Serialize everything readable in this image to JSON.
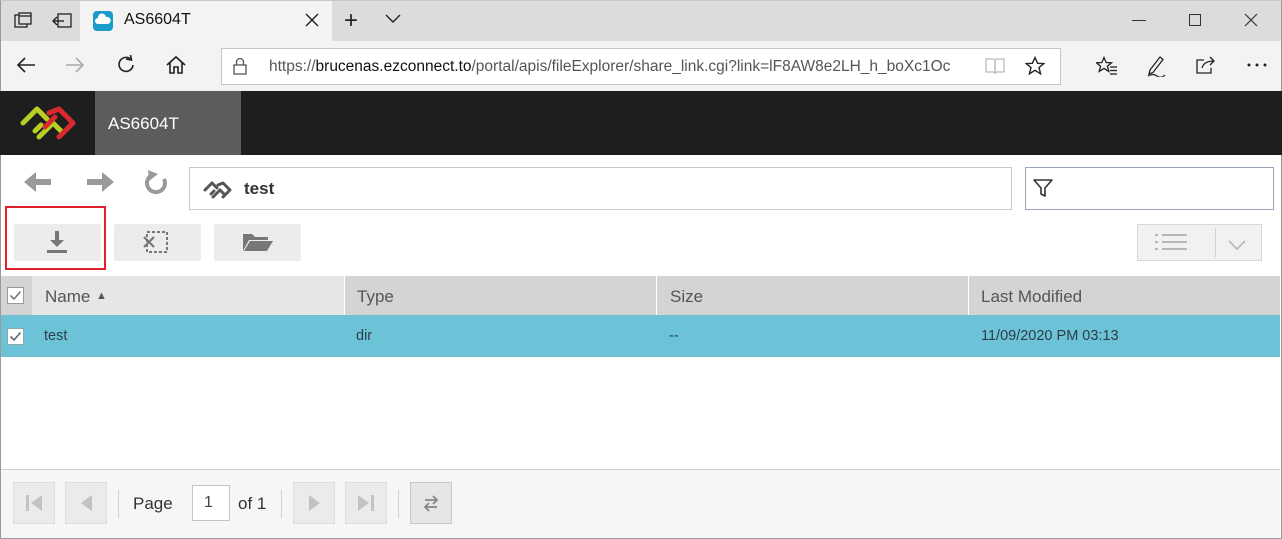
{
  "browser": {
    "tab_title": "AS6604T",
    "url_prefix": "https://",
    "url_host": "brucenas.ezconnect.to",
    "url_path": "/portal/apis/fileExplorer/share_link.cgi?link=lF8AW8e2LH_h_boXc1Oc",
    "new_tab_symbol": "+"
  },
  "app": {
    "title": "AS6604T",
    "path": "test",
    "filter_placeholder": ""
  },
  "grid": {
    "columns": [
      "Name",
      "Type",
      "Size",
      "Last Modified"
    ],
    "sort_indicator": "▲",
    "rows": [
      {
        "name": "test",
        "type": "dir",
        "size": "--",
        "modified": "11/09/2020 PM 03:13",
        "selected": true
      }
    ]
  },
  "pager": {
    "page_label": "Page",
    "page_value": "1",
    "of_label": "of 1"
  },
  "colors": {
    "accent_row": "#6cc3d8",
    "header_bg": "#1e1e1e",
    "highlight_border": "#e0212a"
  }
}
